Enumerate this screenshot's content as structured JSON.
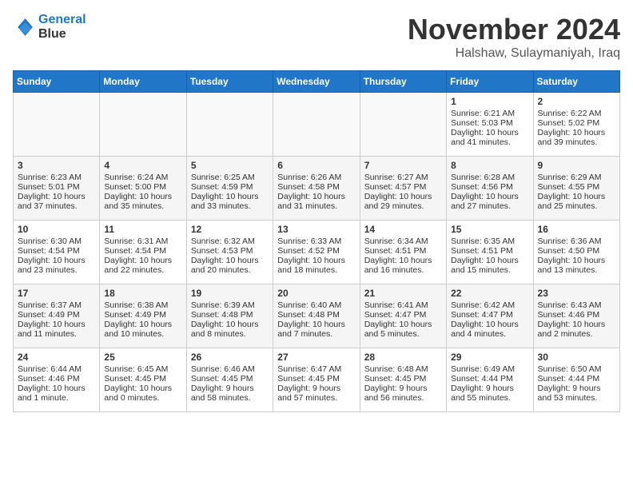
{
  "header": {
    "logo_line1": "General",
    "logo_line2": "Blue",
    "month": "November 2024",
    "location": "Halshaw, Sulaymaniyah, Iraq"
  },
  "weekdays": [
    "Sunday",
    "Monday",
    "Tuesday",
    "Wednesday",
    "Thursday",
    "Friday",
    "Saturday"
  ],
  "weeks": [
    [
      {
        "day": "",
        "lines": []
      },
      {
        "day": "",
        "lines": []
      },
      {
        "day": "",
        "lines": []
      },
      {
        "day": "",
        "lines": []
      },
      {
        "day": "",
        "lines": []
      },
      {
        "day": "1",
        "lines": [
          "Sunrise: 6:21 AM",
          "Sunset: 5:03 PM",
          "Daylight: 10 hours",
          "and 41 minutes."
        ]
      },
      {
        "day": "2",
        "lines": [
          "Sunrise: 6:22 AM",
          "Sunset: 5:02 PM",
          "Daylight: 10 hours",
          "and 39 minutes."
        ]
      }
    ],
    [
      {
        "day": "3",
        "lines": [
          "Sunrise: 6:23 AM",
          "Sunset: 5:01 PM",
          "Daylight: 10 hours",
          "and 37 minutes."
        ]
      },
      {
        "day": "4",
        "lines": [
          "Sunrise: 6:24 AM",
          "Sunset: 5:00 PM",
          "Daylight: 10 hours",
          "and 35 minutes."
        ]
      },
      {
        "day": "5",
        "lines": [
          "Sunrise: 6:25 AM",
          "Sunset: 4:59 PM",
          "Daylight: 10 hours",
          "and 33 minutes."
        ]
      },
      {
        "day": "6",
        "lines": [
          "Sunrise: 6:26 AM",
          "Sunset: 4:58 PM",
          "Daylight: 10 hours",
          "and 31 minutes."
        ]
      },
      {
        "day": "7",
        "lines": [
          "Sunrise: 6:27 AM",
          "Sunset: 4:57 PM",
          "Daylight: 10 hours",
          "and 29 minutes."
        ]
      },
      {
        "day": "8",
        "lines": [
          "Sunrise: 6:28 AM",
          "Sunset: 4:56 PM",
          "Daylight: 10 hours",
          "and 27 minutes."
        ]
      },
      {
        "day": "9",
        "lines": [
          "Sunrise: 6:29 AM",
          "Sunset: 4:55 PM",
          "Daylight: 10 hours",
          "and 25 minutes."
        ]
      }
    ],
    [
      {
        "day": "10",
        "lines": [
          "Sunrise: 6:30 AM",
          "Sunset: 4:54 PM",
          "Daylight: 10 hours",
          "and 23 minutes."
        ]
      },
      {
        "day": "11",
        "lines": [
          "Sunrise: 6:31 AM",
          "Sunset: 4:54 PM",
          "Daylight: 10 hours",
          "and 22 minutes."
        ]
      },
      {
        "day": "12",
        "lines": [
          "Sunrise: 6:32 AM",
          "Sunset: 4:53 PM",
          "Daylight: 10 hours",
          "and 20 minutes."
        ]
      },
      {
        "day": "13",
        "lines": [
          "Sunrise: 6:33 AM",
          "Sunset: 4:52 PM",
          "Daylight: 10 hours",
          "and 18 minutes."
        ]
      },
      {
        "day": "14",
        "lines": [
          "Sunrise: 6:34 AM",
          "Sunset: 4:51 PM",
          "Daylight: 10 hours",
          "and 16 minutes."
        ]
      },
      {
        "day": "15",
        "lines": [
          "Sunrise: 6:35 AM",
          "Sunset: 4:51 PM",
          "Daylight: 10 hours",
          "and 15 minutes."
        ]
      },
      {
        "day": "16",
        "lines": [
          "Sunrise: 6:36 AM",
          "Sunset: 4:50 PM",
          "Daylight: 10 hours",
          "and 13 minutes."
        ]
      }
    ],
    [
      {
        "day": "17",
        "lines": [
          "Sunrise: 6:37 AM",
          "Sunset: 4:49 PM",
          "Daylight: 10 hours",
          "and 11 minutes."
        ]
      },
      {
        "day": "18",
        "lines": [
          "Sunrise: 6:38 AM",
          "Sunset: 4:49 PM",
          "Daylight: 10 hours",
          "and 10 minutes."
        ]
      },
      {
        "day": "19",
        "lines": [
          "Sunrise: 6:39 AM",
          "Sunset: 4:48 PM",
          "Daylight: 10 hours",
          "and 8 minutes."
        ]
      },
      {
        "day": "20",
        "lines": [
          "Sunrise: 6:40 AM",
          "Sunset: 4:48 PM",
          "Daylight: 10 hours",
          "and 7 minutes."
        ]
      },
      {
        "day": "21",
        "lines": [
          "Sunrise: 6:41 AM",
          "Sunset: 4:47 PM",
          "Daylight: 10 hours",
          "and 5 minutes."
        ]
      },
      {
        "day": "22",
        "lines": [
          "Sunrise: 6:42 AM",
          "Sunset: 4:47 PM",
          "Daylight: 10 hours",
          "and 4 minutes."
        ]
      },
      {
        "day": "23",
        "lines": [
          "Sunrise: 6:43 AM",
          "Sunset: 4:46 PM",
          "Daylight: 10 hours",
          "and 2 minutes."
        ]
      }
    ],
    [
      {
        "day": "24",
        "lines": [
          "Sunrise: 6:44 AM",
          "Sunset: 4:46 PM",
          "Daylight: 10 hours",
          "and 1 minute."
        ]
      },
      {
        "day": "25",
        "lines": [
          "Sunrise: 6:45 AM",
          "Sunset: 4:45 PM",
          "Daylight: 10 hours",
          "and 0 minutes."
        ]
      },
      {
        "day": "26",
        "lines": [
          "Sunrise: 6:46 AM",
          "Sunset: 4:45 PM",
          "Daylight: 9 hours",
          "and 58 minutes."
        ]
      },
      {
        "day": "27",
        "lines": [
          "Sunrise: 6:47 AM",
          "Sunset: 4:45 PM",
          "Daylight: 9 hours",
          "and 57 minutes."
        ]
      },
      {
        "day": "28",
        "lines": [
          "Sunrise: 6:48 AM",
          "Sunset: 4:45 PM",
          "Daylight: 9 hours",
          "and 56 minutes."
        ]
      },
      {
        "day": "29",
        "lines": [
          "Sunrise: 6:49 AM",
          "Sunset: 4:44 PM",
          "Daylight: 9 hours",
          "and 55 minutes."
        ]
      },
      {
        "day": "30",
        "lines": [
          "Sunrise: 6:50 AM",
          "Sunset: 4:44 PM",
          "Daylight: 9 hours",
          "and 53 minutes."
        ]
      }
    ]
  ]
}
